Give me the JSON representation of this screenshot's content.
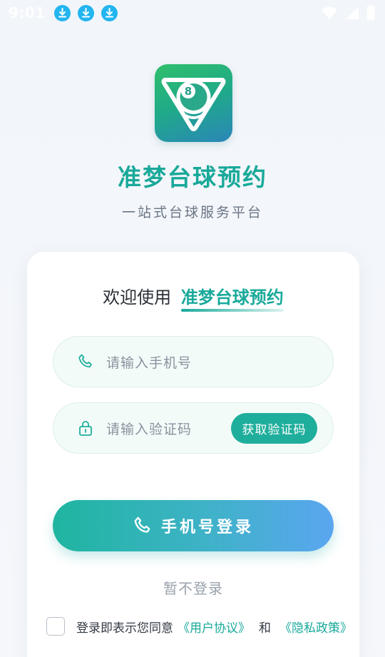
{
  "status_bar": {
    "time": "9:01",
    "notifications": [
      "download-icon",
      "download-icon",
      "download-icon"
    ],
    "right_icons": [
      "wifi-icon",
      "signal-icon",
      "battery-icon"
    ]
  },
  "app": {
    "name": "准梦台球预约",
    "subtitle": "一站式台球服务平台",
    "logo_text": "8"
  },
  "card": {
    "welcome_prefix": "欢迎使用",
    "welcome_brand": "准梦台球预约",
    "phone_placeholder": "请输入手机号",
    "code_placeholder": "请输入验证码",
    "get_code_label": "获取验证码",
    "login_label": "手机号登录",
    "skip_label": "暂不登录",
    "agree_text": "登录即表示您同意",
    "user_agreement": "《用户协议》",
    "and_text": "和",
    "privacy_policy": "《隐私政策》"
  },
  "colors": {
    "accent": "#19a99a",
    "button_gradient_start": "#1fb5a0",
    "button_gradient_end": "#5aa6f0",
    "background": "#f3f6fa"
  }
}
